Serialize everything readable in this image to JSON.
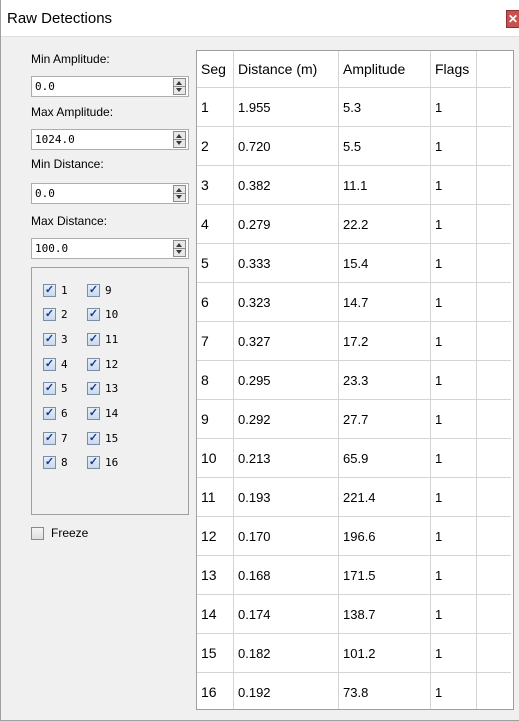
{
  "window": {
    "title": "Raw Detections",
    "close_glyph": "✕"
  },
  "filters": {
    "min_amplitude": {
      "label": "Min Amplitude:",
      "value": "0.0"
    },
    "max_amplitude": {
      "label": "Max Amplitude:",
      "value": "1024.0"
    },
    "min_distance": {
      "label": "Min Distance:",
      "value": "0.0"
    },
    "max_distance": {
      "label": "Max Distance:",
      "value": "100.0"
    }
  },
  "segments": {
    "left": [
      "1",
      "2",
      "3",
      "4",
      "5",
      "6",
      "7",
      "8"
    ],
    "right": [
      "9",
      "10",
      "11",
      "12",
      "13",
      "14",
      "15",
      "16"
    ],
    "checked": true
  },
  "freeze": {
    "label": "Freeze",
    "checked": false
  },
  "table": {
    "headers": [
      "Seg",
      "Distance (m)",
      "Amplitude",
      "Flags",
      ""
    ],
    "rows": [
      [
        "1",
        "1.955",
        "5.3",
        "1"
      ],
      [
        "2",
        "0.720",
        "5.5",
        "1"
      ],
      [
        "3",
        "0.382",
        "11.1",
        "1"
      ],
      [
        "4",
        "0.279",
        "22.2",
        "1"
      ],
      [
        "5",
        "0.333",
        "15.4",
        "1"
      ],
      [
        "6",
        "0.323",
        "14.7",
        "1"
      ],
      [
        "7",
        "0.327",
        "17.2",
        "1"
      ],
      [
        "8",
        "0.295",
        "23.3",
        "1"
      ],
      [
        "9",
        "0.292",
        "27.7",
        "1"
      ],
      [
        "10",
        "0.213",
        "65.9",
        "1"
      ],
      [
        "11",
        "0.193",
        "221.4",
        "1"
      ],
      [
        "12",
        "0.170",
        "196.6",
        "1"
      ],
      [
        "13",
        "0.168",
        "171.5",
        "1"
      ],
      [
        "14",
        "0.174",
        "138.7",
        "1"
      ],
      [
        "15",
        "0.182",
        "101.2",
        "1"
      ],
      [
        "16",
        "0.192",
        "73.8",
        "1"
      ]
    ]
  }
}
